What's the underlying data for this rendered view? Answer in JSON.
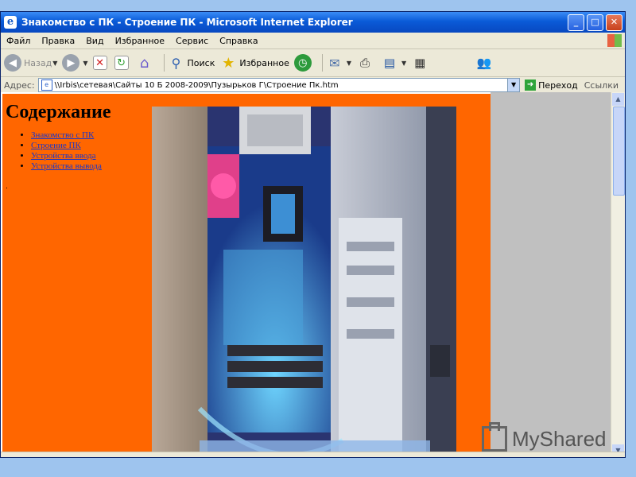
{
  "window": {
    "title": "Знакомство с ПК - Строение ПК - Microsoft Internet Explorer",
    "controls": {
      "minimize": "_",
      "maximize": "□",
      "close": "✕"
    }
  },
  "menu": [
    "Файл",
    "Правка",
    "Вид",
    "Избранное",
    "Сервис",
    "Справка"
  ],
  "toolbar": {
    "back_label": "Назад",
    "search_label": "Поиск",
    "favorites_label": "Избранное"
  },
  "address": {
    "label": "Адрес:",
    "value": "\\\\Irbis\\сетевая\\Сайты 10 Б 2008-2009\\Пузырьков Г\\Строение Пк.htm",
    "go_label": "Переход",
    "links_label": "Ссылки"
  },
  "page": {
    "heading": "Содержание",
    "toc": [
      "Знакомство с ПК",
      "Строение ПК",
      "Устройства ввода",
      "Устройства вывода"
    ],
    "photo_alt_icon": "computer-internals-photo"
  },
  "watermark": "MyShared",
  "colors": {
    "page_background": "#ff6600",
    "titlebar": "#0a5bd8",
    "link": "#1a35c8",
    "gray_area": "#c0c0c0"
  }
}
